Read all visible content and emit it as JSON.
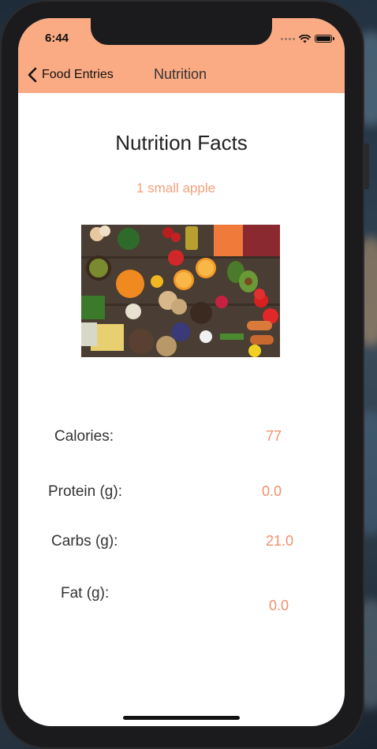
{
  "status_bar": {
    "time": "6:44"
  },
  "nav": {
    "back_label": "Food Entries",
    "title": "Nutrition"
  },
  "page": {
    "heading": "Nutrition Facts",
    "food_name": "1 small apple"
  },
  "nutrients": [
    {
      "label": "Calories:",
      "value": "77"
    },
    {
      "label": "Protein (g):",
      "value": "0.0"
    },
    {
      "label": "Carbs (g):",
      "value": "21.0"
    },
    {
      "label": "Fat (g):",
      "value": "0.0"
    }
  ],
  "colors": {
    "nav_bar": "#fbab84",
    "accent_text": "#f0906a",
    "food_name": "#f4a07c"
  },
  "icons": [
    "chevron-left-icon",
    "wifi-icon",
    "battery-icon",
    "signal-icon"
  ]
}
